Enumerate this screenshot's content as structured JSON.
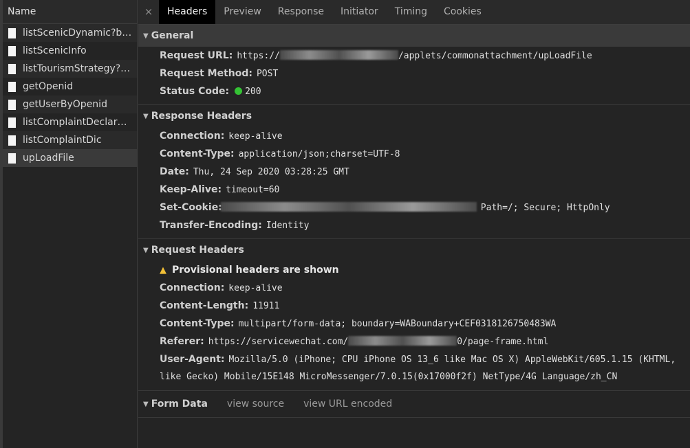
{
  "sidebar": {
    "header": "Name",
    "items": [
      {
        "label": "listScenicDynamic?be..."
      },
      {
        "label": "listScenicInfo"
      },
      {
        "label": "listTourismStrategy?be..."
      },
      {
        "label": "getOpenid"
      },
      {
        "label": "getUserByOpenid"
      },
      {
        "label": "listComplaintDeclarati..."
      },
      {
        "label": "listComplaintDic"
      },
      {
        "label": "upLoadFile"
      }
    ]
  },
  "tabs": [
    "Headers",
    "Preview",
    "Response",
    "Initiator",
    "Timing",
    "Cookies"
  ],
  "close_glyph": "×",
  "general": {
    "title": "General",
    "request_url_key": "Request URL:",
    "request_url_prefix": "https://",
    "request_url_suffix": "/applets/commonattachment/upLoadFile",
    "request_method_key": "Request Method:",
    "request_method": "POST",
    "status_code_key": "Status Code:",
    "status_code": "200",
    "status_color": "#34c234"
  },
  "response_headers": {
    "title": "Response Headers",
    "connection_key": "Connection:",
    "connection": "keep-alive",
    "content_type_key": "Content-Type:",
    "content_type": "application/json;charset=UTF-8",
    "date_key": "Date:",
    "date": "Thu, 24 Sep 2020 03:28:25 GMT",
    "keep_alive_key": "Keep-Alive:",
    "keep_alive": "timeout=60",
    "set_cookie_key": "Set-Cookie:",
    "set_cookie_suffix": "Path=/; Secure; HttpOnly",
    "transfer_encoding_key": "Transfer-Encoding:",
    "transfer_encoding": "Identity"
  },
  "request_headers": {
    "title": "Request Headers",
    "provisional": "Provisional headers are shown",
    "connection_key": "Connection:",
    "connection": "keep-alive",
    "content_length_key": "Content-Length:",
    "content_length": "11911",
    "content_type_key": "Content-Type:",
    "content_type": "multipart/form-data; boundary=WABoundary+CEF0318126750483WA",
    "referer_key": "Referer:",
    "referer_prefix": "https://servicewechat.com/",
    "referer_suffix": "0/page-frame.html",
    "user_agent_key": "User-Agent:",
    "user_agent_line1": "Mozilla/5.0 (iPhone; CPU iPhone OS 13_6 like Mac OS X) AppleWebKit/605.1.15 (KHTML,",
    "user_agent_line2": "like Gecko) Mobile/15E148 MicroMessenger/7.0.15(0x17000f2f) NetType/4G Language/zh_CN"
  },
  "form_data": {
    "title": "Form Data",
    "view_source": "view source",
    "view_url_encoded": "view URL encoded"
  }
}
